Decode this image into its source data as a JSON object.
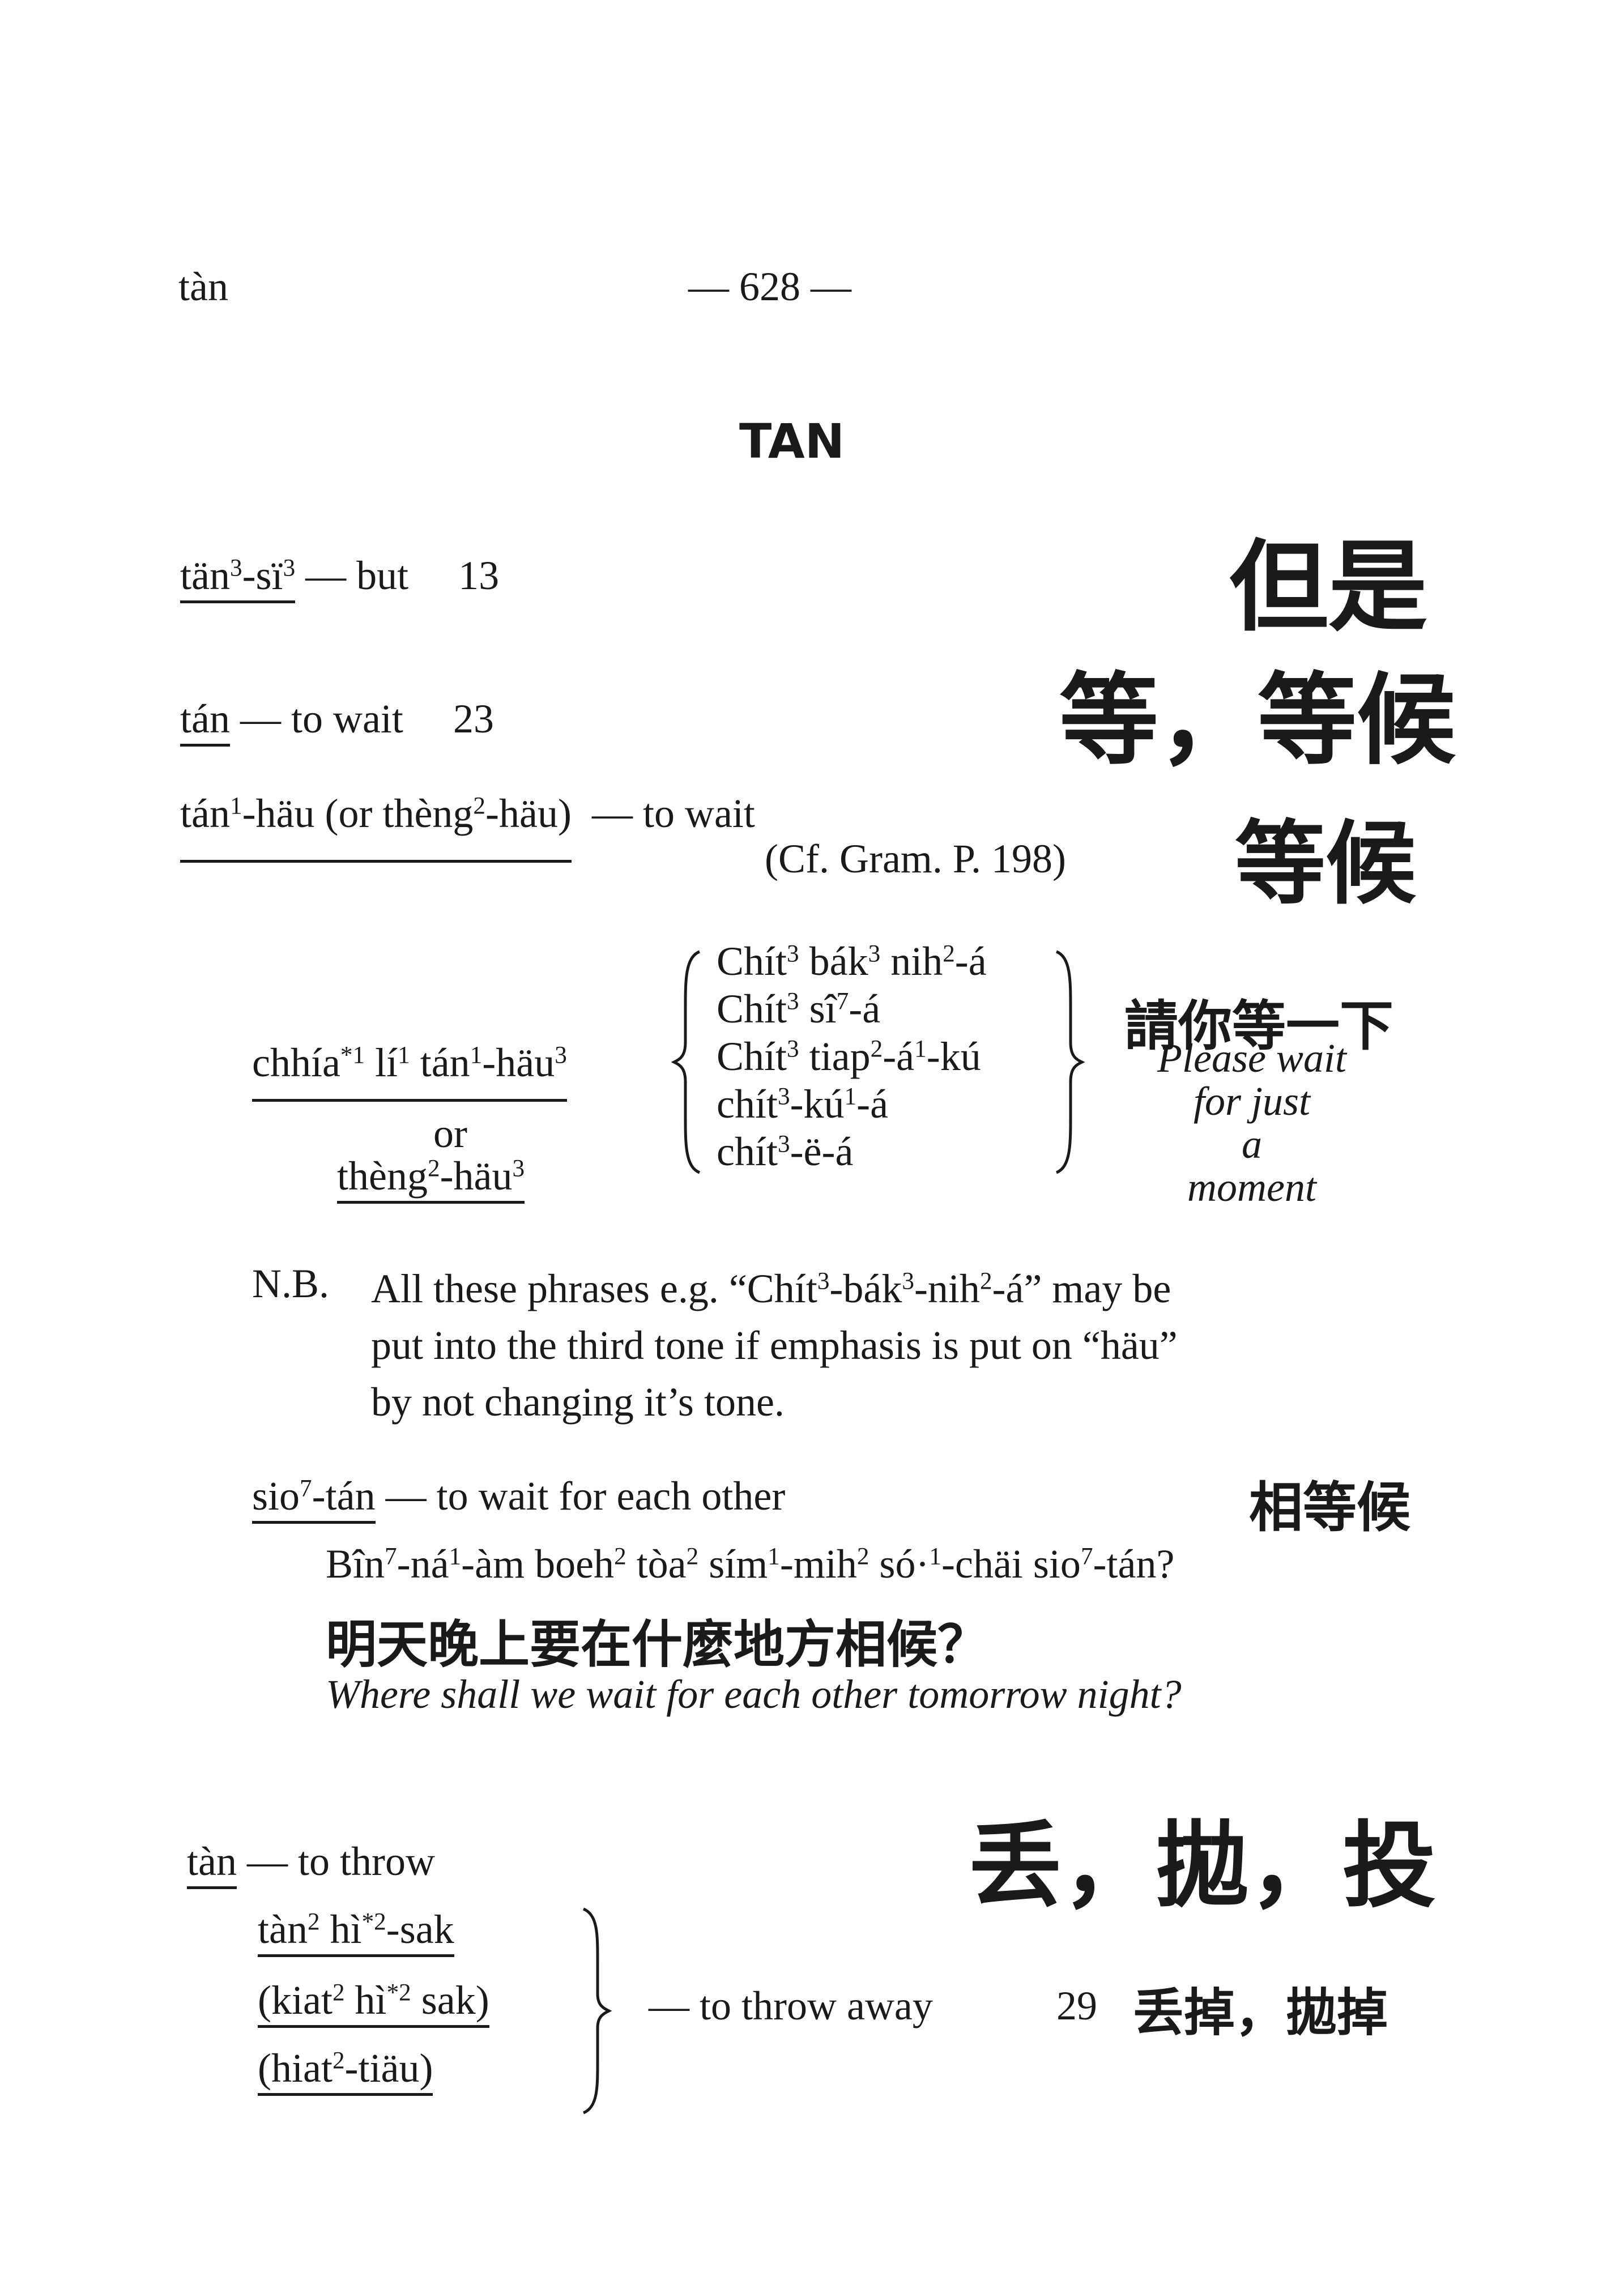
{
  "header": {
    "left": "tàn",
    "page_number": "— 628 —"
  },
  "section_title": "TAN",
  "entries": {
    "e1": {
      "rom": "tän³-sï³",
      "def": "— but",
      "num": "13",
      "han": "但是"
    },
    "e2": {
      "rom": "tán",
      "def": "— to wait",
      "num": "23",
      "han": "等，等候"
    },
    "e3": {
      "rom": "tán¹-häu (or thèng²-häu)",
      "def": "— to wait",
      "ref": "(Cf. Gram. P. 198)",
      "han": "等候"
    },
    "e4": {
      "left_main": "chhía*¹ lí¹ tán¹-häu³",
      "left_or": "or",
      "left_alt": "thèng²-häu³",
      "options": [
        "Chít³ bák³ nih²-á",
        "Chít³ sî⁷-á",
        "Chít³ tiap²-á¹-kú",
        "chít³-kú¹-á",
        "chít³-ë-á"
      ],
      "han": "請你等一下",
      "translation": [
        "Please wait",
        "for just",
        "a",
        "moment"
      ]
    },
    "nb": {
      "label": "N.B.",
      "lines": [
        "All these phrases e.g. “Chít³-bák³-nih²-á” may be",
        "put into the third tone if emphasis is put on “häu”",
        "by not changing it’s tone."
      ]
    },
    "e5": {
      "rom": "sio⁷-tán",
      "def": "— to wait for each other",
      "han": "相等候",
      "example": "Bîn⁷-ná¹-àm boeh² tòa² sím¹-mih² só·¹-chäi sio⁷-tán?",
      "example_han": "明天晚上要在什麼地方相候？",
      "example_en": "Where shall we wait for each other tomorrow night?"
    },
    "e6": {
      "rom": "tàn",
      "def": "— to throw",
      "han": "丢，拋，投",
      "options": [
        "tàn² hì*²-sak",
        "(kiat² hì*² sak)",
        "(hiat²-tiäu)"
      ],
      "def2": "— to throw away",
      "num": "29",
      "han2": "丢掉，拋掉"
    }
  }
}
